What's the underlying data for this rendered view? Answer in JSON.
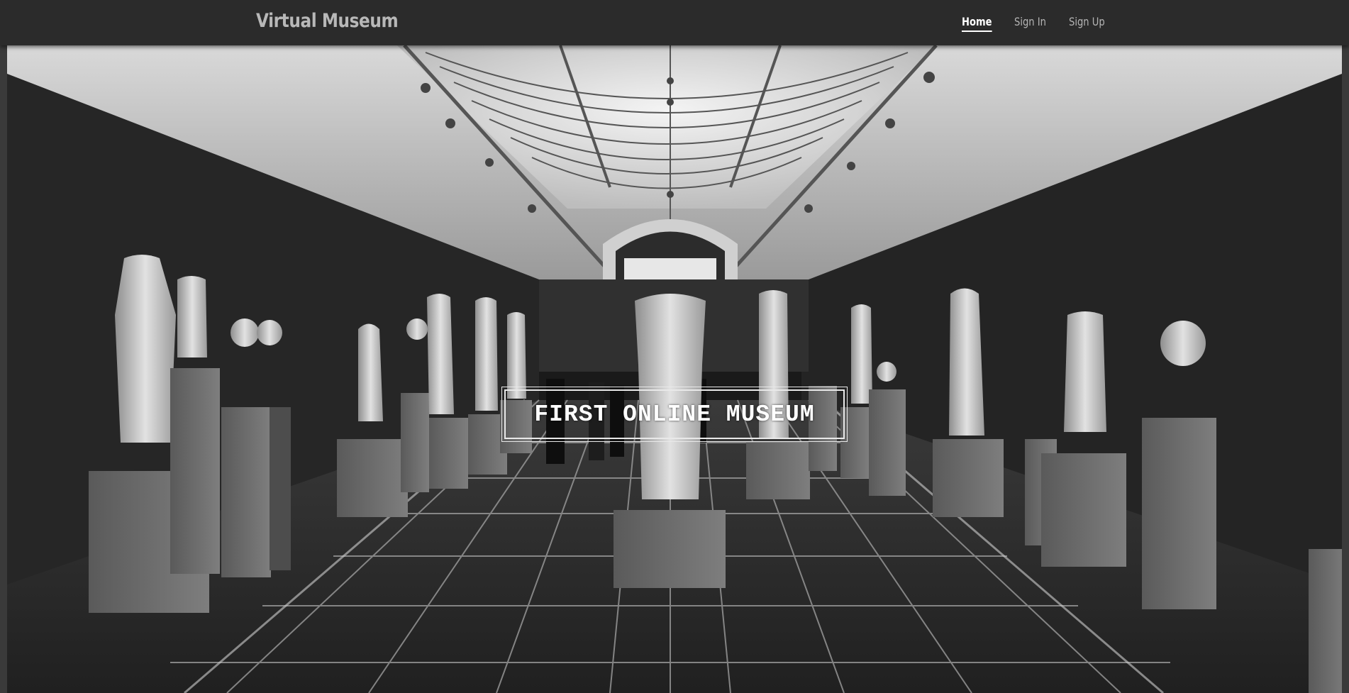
{
  "navbar": {
    "brand": "Virtual Museum",
    "links": [
      {
        "label": "Home",
        "active": true
      },
      {
        "label": "Sign In",
        "active": false
      },
      {
        "label": "Sign Up",
        "active": false
      }
    ]
  },
  "hero": {
    "title": "FIRST ONLINE MUSEUM",
    "image_subject": "black-and-white museum gallery hall with classical sculptures"
  },
  "colors": {
    "navbar_bg": "#2b2b2b",
    "brand_text": "#b8b8b8",
    "link_text": "#b5b5b5",
    "active_link": "#ffffff"
  }
}
